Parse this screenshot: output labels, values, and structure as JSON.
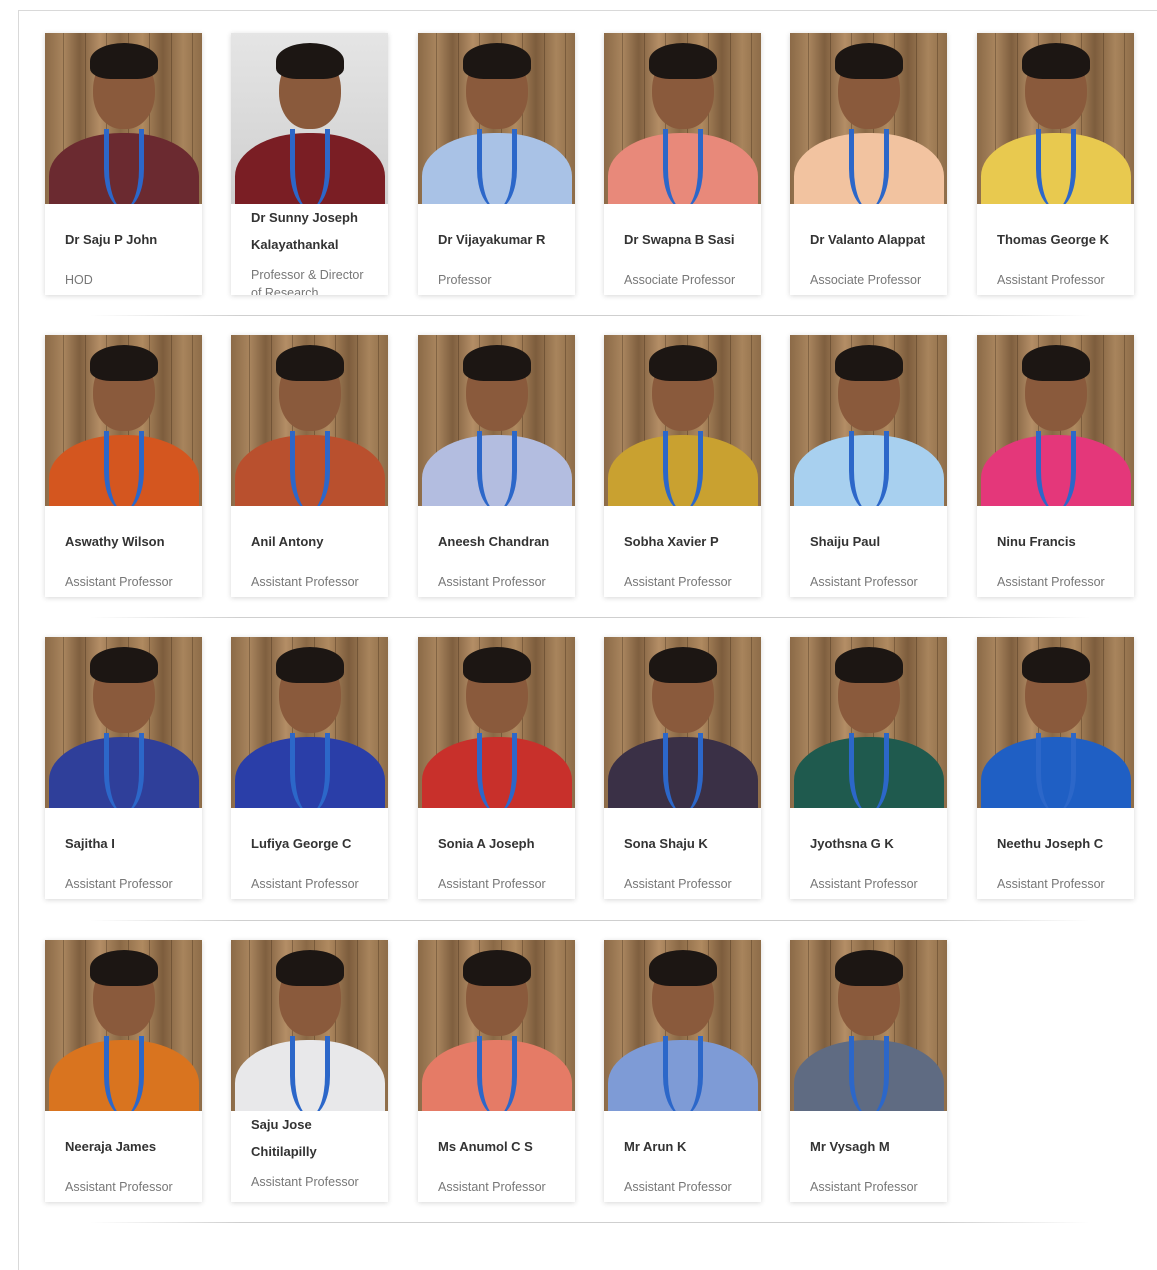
{
  "rows": [
    [
      {
        "name": "Dr Saju P John",
        "role": "HOD",
        "shirt": "#6b2a30",
        "bg": "wood"
      },
      {
        "name": "Dr Sunny Joseph Kalayathankal",
        "role": "Professor & Director of Research",
        "shirt": "#7a1e24",
        "bg": "grey"
      },
      {
        "name": "Dr Vijayakumar R",
        "role": "Professor",
        "shirt": "#a9c2e6",
        "bg": "wood"
      },
      {
        "name": "Dr Swapna B Sasi",
        "role": "Associate Professor",
        "shirt": "#e8897a",
        "bg": "wood"
      },
      {
        "name": "Dr Valanto Alappat",
        "role": "Associate Professor",
        "shirt": "#f2c3a0",
        "bg": "wood"
      },
      {
        "name": "Thomas George K",
        "role": "Assistant Professor",
        "shirt": "#e8c94f",
        "bg": "wood"
      }
    ],
    [
      {
        "name": "Aswathy Wilson",
        "role": "Assistant Professor",
        "shirt": "#d4561f",
        "bg": "wood"
      },
      {
        "name": "Anil Antony",
        "role": "Assistant Professor",
        "shirt": "#b9502e",
        "bg": "wood"
      },
      {
        "name": "Aneesh Chandran",
        "role": "Assistant Professor",
        "shirt": "#b3bde0",
        "bg": "wood"
      },
      {
        "name": "Sobha Xavier P",
        "role": "Assistant Professor",
        "shirt": "#c9a130",
        "bg": "wood"
      },
      {
        "name": "Shaiju Paul",
        "role": "Assistant Professor",
        "shirt": "#a8d0ef",
        "bg": "wood"
      },
      {
        "name": "Ninu Francis",
        "role": "Assistant Professor",
        "shirt": "#e4377a",
        "bg": "wood"
      }
    ],
    [
      {
        "name": "Sajitha I",
        "role": "Assistant Professor",
        "shirt": "#2f3f9a",
        "bg": "wood"
      },
      {
        "name": "Lufiya George C",
        "role": "Assistant Professor",
        "shirt": "#2a3ea8",
        "bg": "wood"
      },
      {
        "name": "Sonia A Joseph",
        "role": "Assistant Professor",
        "shirt": "#c8302b",
        "bg": "wood"
      },
      {
        "name": "Sona Shaju K",
        "role": "Assistant Professor",
        "shirt": "#3a3046",
        "bg": "wood"
      },
      {
        "name": "Jyothsna G K",
        "role": "Assistant Professor",
        "shirt": "#1f5a4e",
        "bg": "wood"
      },
      {
        "name": "Neethu Joseph C",
        "role": "Assistant Professor",
        "shirt": "#1f5fc4",
        "bg": "wood"
      }
    ],
    [
      {
        "name": "Neeraja James",
        "role": "Assistant Professor",
        "shirt": "#d9741f",
        "bg": "wood"
      },
      {
        "name": "Saju Jose Chitilapilly",
        "role": "Assistant Professor",
        "shirt": "#e8e8ea",
        "bg": "wood"
      },
      {
        "name": "Ms Anumol C S",
        "role": "Assistant Professor",
        "shirt": "#e57b66",
        "bg": "wood"
      },
      {
        "name": "Mr Arun K",
        "role": "Assistant Professor",
        "shirt": "#7e9bd6",
        "bg": "wood"
      },
      {
        "name": "Mr Vysagh M",
        "role": "Assistant Professor",
        "shirt": "#5f6b82",
        "bg": "wood"
      }
    ]
  ]
}
